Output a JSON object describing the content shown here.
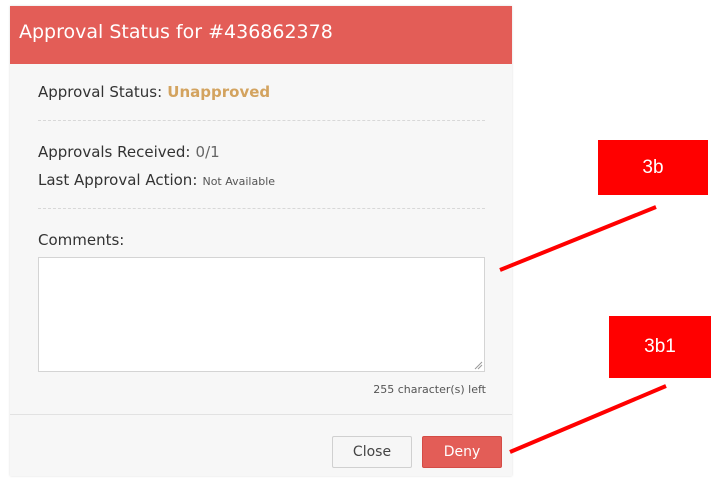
{
  "dialog": {
    "title": "Approval Status for #436862378",
    "approval_status_label": "Approval Status:",
    "approval_status_value": "Unapproved",
    "approvals_received_label": "Approvals Received:",
    "approvals_received_value": "0/1",
    "last_action_label": "Last Approval Action:",
    "last_action_value": "Not Available",
    "comments_label": "Comments:",
    "comments_value": "",
    "char_left": "255 character(s) left",
    "close_label": "Close",
    "deny_label": "Deny"
  },
  "annotations": {
    "callout_1": "3b",
    "callout_2": "3b1"
  },
  "colors": {
    "header": "#e35d57",
    "status_unapproved": "#d3a35f",
    "callout": "#ff0000"
  }
}
